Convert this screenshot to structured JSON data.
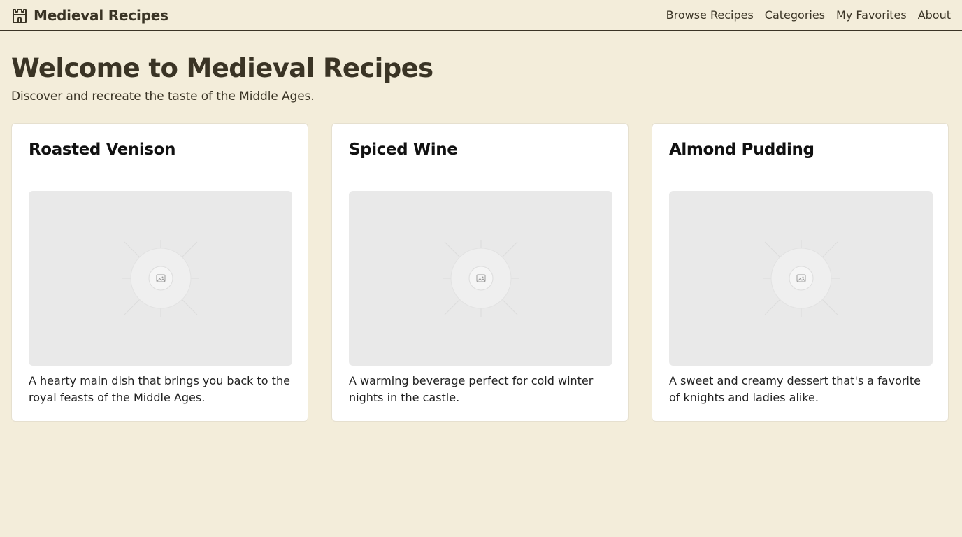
{
  "nav": {
    "brand": "Medieval Recipes",
    "brand_icon": "castle-icon",
    "links": [
      {
        "label": "Browse Recipes"
      },
      {
        "label": "Categories"
      },
      {
        "label": "My Favorites"
      },
      {
        "label": "About"
      }
    ]
  },
  "hero": {
    "title": "Welcome to Medieval Recipes",
    "subtitle": "Discover and recreate the taste of the Middle Ages."
  },
  "cards": [
    {
      "title": "Roasted Venison",
      "image_icon": "image-placeholder-icon",
      "description": "A hearty main dish that brings you back to the royal feasts of the Middle Ages."
    },
    {
      "title": "Spiced Wine",
      "image_icon": "image-placeholder-icon",
      "description": "A warming beverage perfect for cold winter nights in the castle."
    },
    {
      "title": "Almond Pudding",
      "image_icon": "image-placeholder-icon",
      "description": "A sweet and creamy dessert that's a favorite of knights and ladies alike."
    }
  ],
  "colors": {
    "background": "#f3edda",
    "text": "#3a3425",
    "card": "#ffffff",
    "image_placeholder": "#e9e9e9"
  }
}
